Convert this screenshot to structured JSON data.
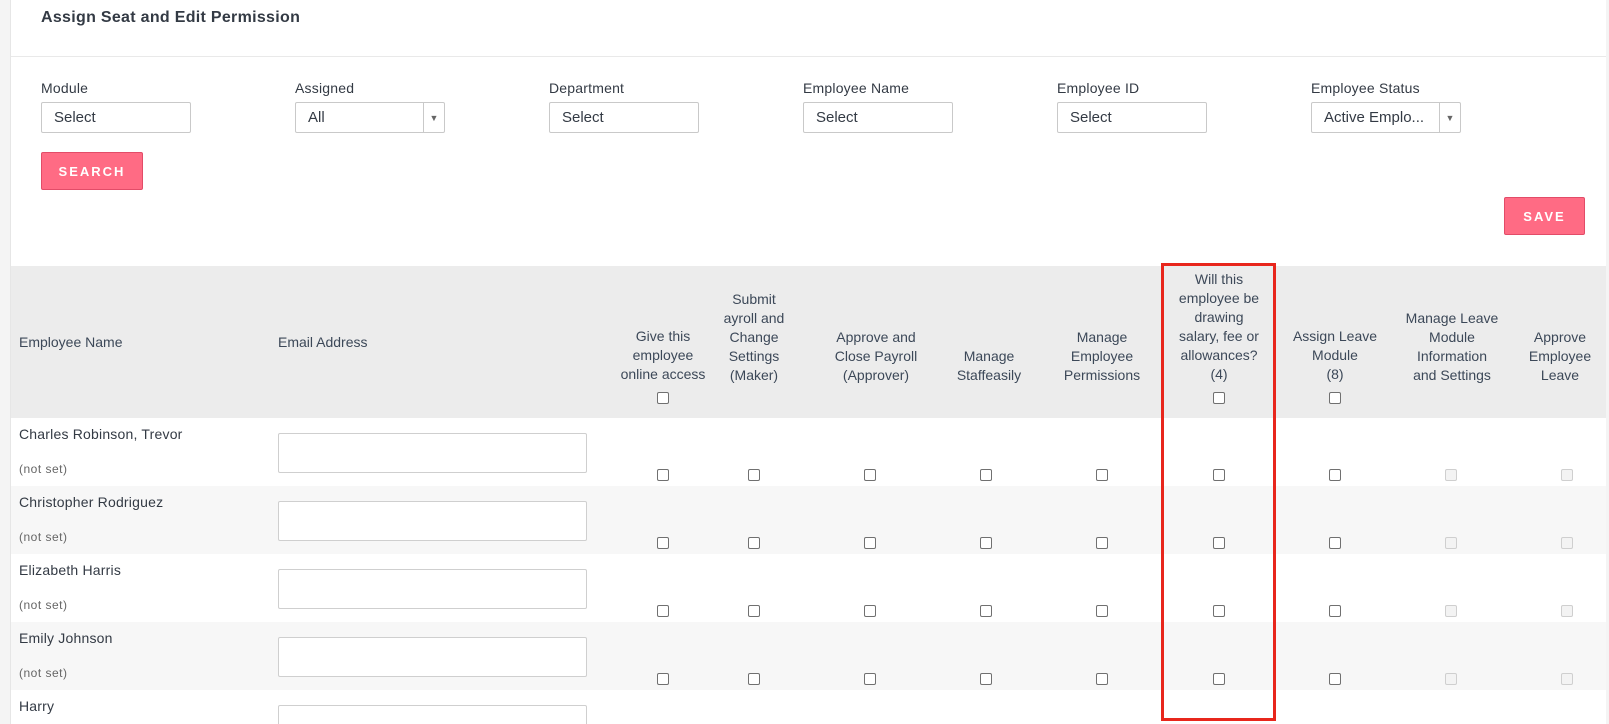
{
  "page": {
    "title": "Assign Seat and Edit Permission"
  },
  "filters": {
    "module": {
      "label": "Module",
      "value": "Select"
    },
    "assigned": {
      "label": "Assigned",
      "value": "All"
    },
    "department": {
      "label": "Department",
      "value": "Select"
    },
    "employee_name": {
      "label": "Employee Name",
      "value": "Select"
    },
    "employee_id": {
      "label": "Employee ID",
      "value": "Select"
    },
    "employee_status": {
      "label": "Employee Status",
      "value": "Active Emplo..."
    }
  },
  "buttons": {
    "search": "SEARCH",
    "save": "SAVE"
  },
  "table": {
    "columns": {
      "employee_name": "Employee Name",
      "email": "Email Address",
      "online_access": [
        "Give this",
        "employee",
        "online access"
      ],
      "submit_payroll": [
        "Submit",
        "ayroll and",
        "Change",
        "Settings",
        "(Maker)"
      ],
      "approve_payroll": [
        "Approve and",
        "Close Payroll",
        "(Approver)"
      ],
      "manage_staffeasily": [
        "Manage",
        "Staffeasily"
      ],
      "manage_permissions": [
        "Manage",
        "Employee",
        "Permissions"
      ],
      "salary": [
        "Will this",
        "employee be",
        "drawing",
        "salary, fee or",
        "allowances?",
        "(4)"
      ],
      "assign_leave": [
        "Assign Leave",
        "Module",
        "(8)"
      ],
      "manage_leave": [
        "Manage Leave",
        "Module",
        "Information",
        "and Settings"
      ],
      "approve_leave": [
        "Approve",
        "Employee",
        "Leave"
      ]
    },
    "rows": [
      {
        "name": "Charles Robinson, Trevor",
        "status": "(not set)"
      },
      {
        "name": "Christopher Rodriguez",
        "status": "(not set)"
      },
      {
        "name": "Elizabeth Harris",
        "status": "(not set)"
      },
      {
        "name": "Emily Johnson",
        "status": "(not set)"
      },
      {
        "name": "Harry",
        "status": ""
      }
    ]
  },
  "colors": {
    "accent": "#ff6b84",
    "highlight_border": "#e8261c",
    "header_bg": "#ececec"
  }
}
